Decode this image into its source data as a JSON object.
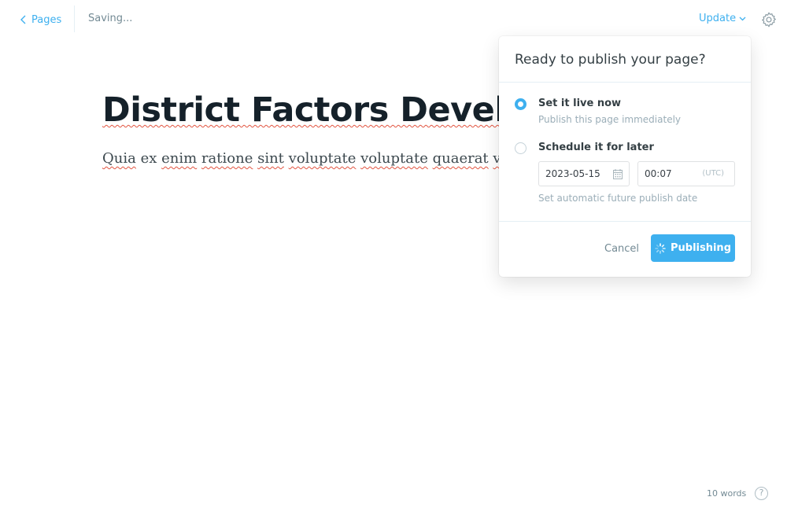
{
  "topbar": {
    "back_label": "Pages",
    "status": "Saving...",
    "update_label": "Update"
  },
  "editor": {
    "title": "District Factors Develop",
    "body_words": [
      "Quia",
      "ex",
      "enim",
      "ratione",
      "sint",
      "voluptate",
      "voluptate",
      "quaerat",
      "vol"
    ]
  },
  "publish_menu": {
    "heading": "Ready to publish your page?",
    "option_now_label": "Set it live now",
    "option_now_desc": "Publish this page immediately",
    "option_later_label": "Schedule it for later",
    "date_value": "2023-05-15",
    "time_value": "00:07",
    "timezone": "(UTC)",
    "later_hint": "Set automatic future publish date",
    "cancel_label": "Cancel",
    "publish_label": "Publishing",
    "selected_option": "now"
  },
  "footer": {
    "word_count": "10 words",
    "help_label": "?"
  },
  "colors": {
    "accent": "#3eb0ef",
    "text": "#15212a",
    "muted": "#738a94"
  }
}
